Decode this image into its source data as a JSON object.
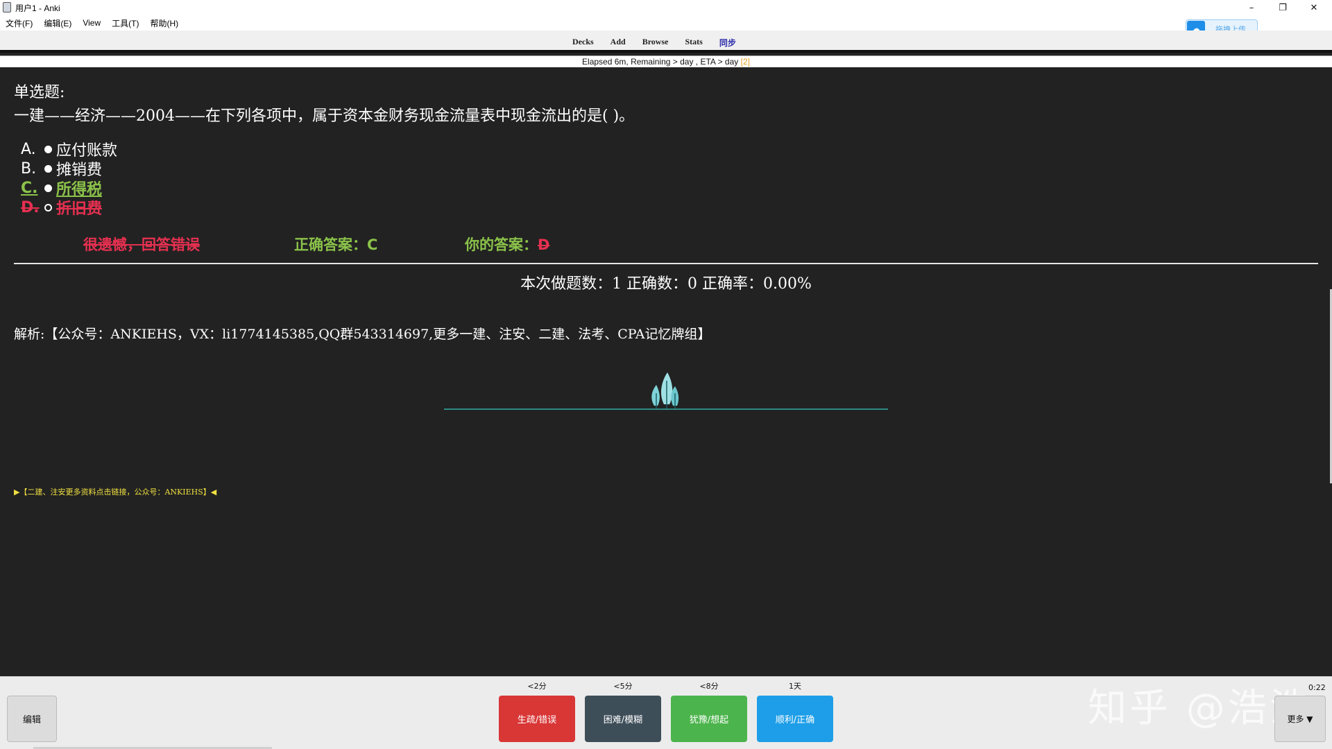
{
  "window": {
    "title": "用户1 - Anki",
    "minimize": "–",
    "maximize": "❐",
    "close": "✕"
  },
  "menu": [
    "文件(F)",
    "编辑(E)",
    "View",
    "工具(T)",
    "帮助(H)"
  ],
  "upload_widget": {
    "label": "拖拽上传",
    "logo": "☁"
  },
  "toolbar": {
    "links": [
      "Decks",
      "Add",
      "Browse",
      "Stats",
      "同步"
    ]
  },
  "status": {
    "text": "Elapsed 6m, Remaining > day , ETA > day ",
    "sub": "[2]"
  },
  "card": {
    "qtype": "单选题:",
    "question": "一建——经济——2004——在下列各项中，属于资本金财务现金流量表中现金流出的是( )。",
    "options": [
      {
        "letter": "A.",
        "text": "应付账款",
        "state": "normal"
      },
      {
        "letter": "B.",
        "text": "摊销费",
        "state": "normal"
      },
      {
        "letter": "C.",
        "text": "所得税",
        "state": "correct"
      },
      {
        "letter": "D.",
        "text": "折旧费",
        "state": "wrong"
      }
    ],
    "result": {
      "verdict": "很遗憾，回答错误",
      "correct_label": "正确答案：",
      "correct_value": "C",
      "yours_label": "你的答案：",
      "yours_value": "D"
    },
    "stats": "本次做题数：1 正确数：0 正确率：0.00%",
    "analysis": "解析:【公众号：ANKIEHS，VX：li1774145385,QQ群543314697,更多一建、注安、二建、法考、CPA记忆牌组】",
    "footer_link": "▶【二建、注安更多资料点击链接，公众号：ANKIEHS】◀"
  },
  "bottom": {
    "edit": "编辑",
    "ease": [
      {
        "interval": "<2分",
        "label": "生疏/错误",
        "color": "#d93636"
      },
      {
        "interval": "<5分",
        "label": "困难/模糊",
        "color": "#3e4e59"
      },
      {
        "interval": "<8分",
        "label": "犹豫/想起",
        "color": "#4cb44c"
      },
      {
        "interval": "1天",
        "label": "顺利/正确",
        "color": "#1e9ee8"
      }
    ],
    "timer": "0:22",
    "more": "更多 ▼",
    "watermark": "知乎 @浩浩"
  }
}
